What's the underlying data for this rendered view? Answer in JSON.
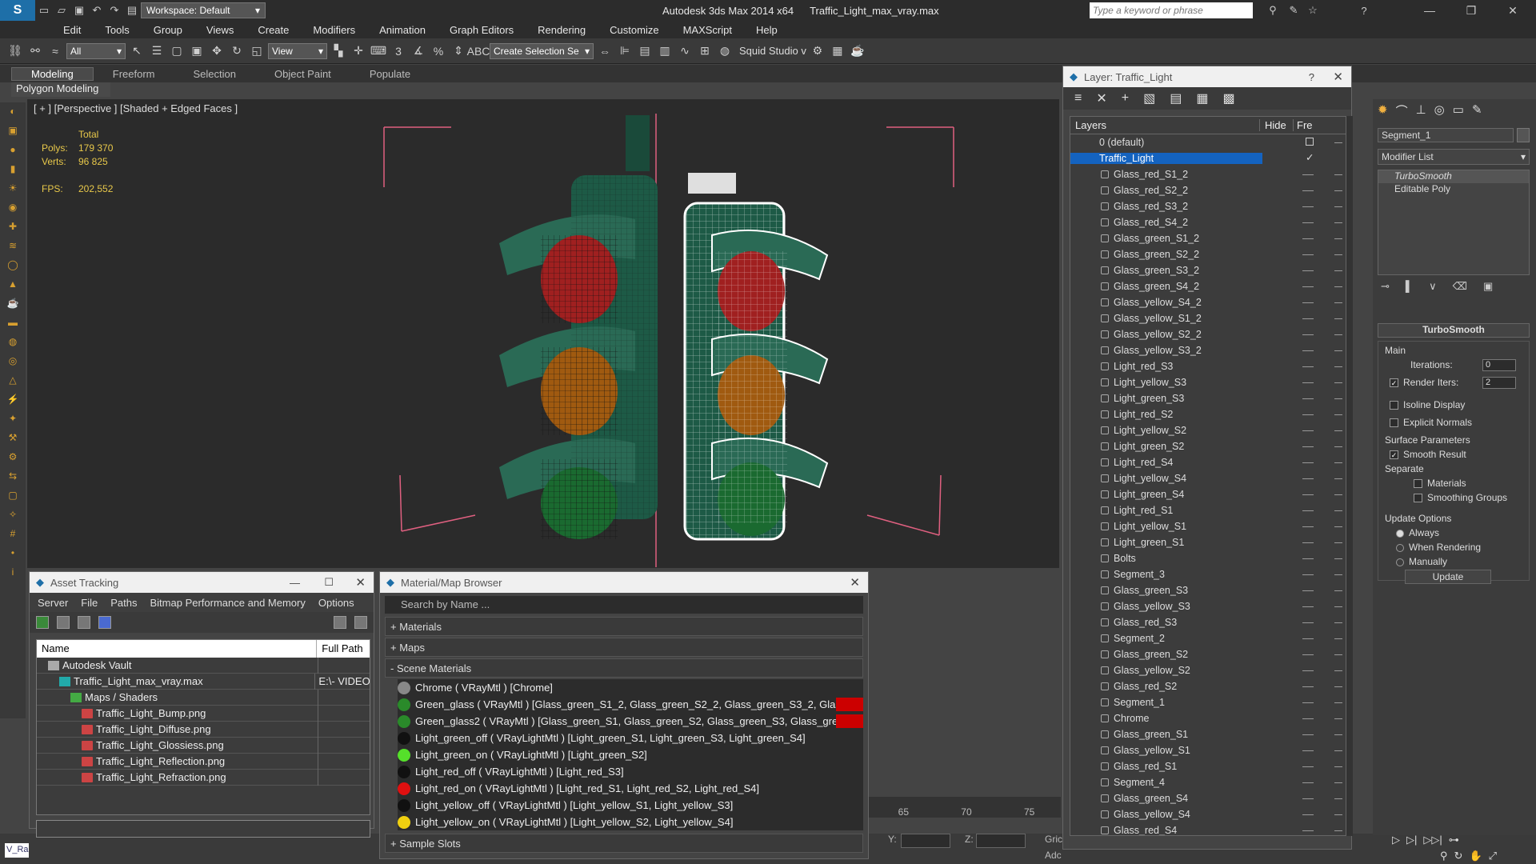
{
  "app": {
    "title": "Autodesk 3ds Max 2014 x64",
    "file": "Traffic_Light_max_vray.max",
    "workspace": "Workspace: Default",
    "search_placeholder": "Type a keyword or phrase"
  },
  "menu": [
    "Edit",
    "Tools",
    "Group",
    "Views",
    "Create",
    "Modifiers",
    "Animation",
    "Graph Editors",
    "Rendering",
    "Customize",
    "MAXScript",
    "Help"
  ],
  "toolbar": {
    "filter": "All",
    "refcoord": "View",
    "selection_set": "Create Selection Se",
    "squid": "Squid Studio v"
  },
  "ribbon": {
    "tabs": [
      "Modeling",
      "Freeform",
      "Selection",
      "Object Paint",
      "Populate"
    ],
    "sub": "Polygon Modeling"
  },
  "viewport": {
    "label": "[ + ] [Perspective ] [Shaded + Edged Faces ]",
    "total_label": "Total",
    "polys_label": "Polys:",
    "polys": "179 370",
    "verts_label": "Verts:",
    "verts": "96 825",
    "fps_label": "FPS:",
    "fps": "202,552"
  },
  "asset_tracking": {
    "title": "Asset Tracking",
    "menu": [
      "Server",
      "File",
      "Paths",
      "Bitmap Performance and Memory",
      "Options"
    ],
    "col_name": "Name",
    "col_path": "Full Path",
    "rows": [
      {
        "name": "Autodesk Vault",
        "path": "",
        "indent": 1,
        "icon": "vault"
      },
      {
        "name": "Traffic_Light_max_vray.max",
        "path": "E:\\- VIDEO",
        "indent": 2,
        "icon": "max"
      },
      {
        "name": "Maps / Shaders",
        "path": "",
        "indent": 3,
        "icon": "folder"
      },
      {
        "name": "Traffic_Light_Bump.png",
        "path": "",
        "indent": 4,
        "icon": "png"
      },
      {
        "name": "Traffic_Light_Diffuse.png",
        "path": "",
        "indent": 4,
        "icon": "png"
      },
      {
        "name": "Traffic_Light_Glossiess.png",
        "path": "",
        "indent": 4,
        "icon": "png"
      },
      {
        "name": "Traffic_Light_Reflection.png",
        "path": "",
        "indent": 4,
        "icon": "png"
      },
      {
        "name": "Traffic_Light_Refraction.png",
        "path": "",
        "indent": 4,
        "icon": "png"
      }
    ]
  },
  "material_browser": {
    "title": "Material/Map Browser",
    "search_placeholder": "Search by Name ...",
    "sec_materials": "+ Materials",
    "sec_maps": "+ Maps",
    "sec_scene": "- Scene Materials",
    "sec_samples": "+ Sample Slots",
    "rows": [
      {
        "label": "Chrome  ( VRayMtl )  [Chrome]",
        "color": "#888888",
        "flag": false
      },
      {
        "label": "Green_glass  ( VRayMtl )  [Glass_green_S1_2, Glass_green_S2_2, Glass_green_S3_2, Glass_...",
        "color": "#2a8a2a",
        "flag": true
      },
      {
        "label": "Green_glass2  ( VRayMtl )  [Glass_green_S1, Glass_green_S2, Glass_green_S3, Glass_green...",
        "color": "#2a8a2a",
        "flag": true
      },
      {
        "label": "Light_green_off  ( VRayLightMtl )  [Light_green_S1, Light_green_S3, Light_green_S4]",
        "color": "#111111",
        "flag": false
      },
      {
        "label": "Light_green_on  ( VRayLightMtl )  [Light_green_S2]",
        "color": "#55e02a",
        "flag": false
      },
      {
        "label": "Light_red_off  ( VRayLightMtl )  [Light_red_S3]",
        "color": "#111111",
        "flag": false
      },
      {
        "label": "Light_red_on  ( VRayLightMtl )  [Light_red_S1, Light_red_S2, Light_red_S4]",
        "color": "#e01010",
        "flag": false
      },
      {
        "label": "Light_yellow_off  ( VRayLightMtl )  [Light_yellow_S1, Light_yellow_S3]",
        "color": "#111111",
        "flag": false
      },
      {
        "label": "Light_yellow_on  ( VRayLightMtl )  [Light_yellow_S2, Light_yellow_S4]",
        "color": "#f0d010",
        "flag": false
      }
    ]
  },
  "layer_explorer": {
    "title": "Layer: Traffic_Light",
    "col_layers": "Layers",
    "col_hide": "Hide",
    "col_freeze": "Fre",
    "default_layer": "0 (default)",
    "active_layer": "Traffic_Light",
    "items": [
      "Glass_red_S1_2",
      "Glass_red_S2_2",
      "Glass_red_S3_2",
      "Glass_red_S4_2",
      "Glass_green_S1_2",
      "Glass_green_S2_2",
      "Glass_green_S3_2",
      "Glass_green_S4_2",
      "Glass_yellow_S4_2",
      "Glass_yellow_S1_2",
      "Glass_yellow_S2_2",
      "Glass_yellow_S3_2",
      "Light_red_S3",
      "Light_yellow_S3",
      "Light_green_S3",
      "Light_red_S2",
      "Light_yellow_S2",
      "Light_green_S2",
      "Light_red_S4",
      "Light_yellow_S4",
      "Light_green_S4",
      "Light_red_S1",
      "Light_yellow_S1",
      "Light_green_S1",
      "Bolts",
      "Segment_3",
      "Glass_green_S3",
      "Glass_yellow_S3",
      "Glass_red_S3",
      "Segment_2",
      "Glass_green_S2",
      "Glass_yellow_S2",
      "Glass_red_S2",
      "Segment_1",
      "Chrome",
      "Glass_green_S1",
      "Glass_yellow_S1",
      "Glass_red_S1",
      "Segment_4",
      "Glass_green_S4",
      "Glass_yellow_S4",
      "Glass_red_S4"
    ]
  },
  "command_panel": {
    "object_name": "Segment_1",
    "modifier_list": "Modifier List",
    "stack": [
      "TurboSmooth",
      "Editable Poly"
    ],
    "rollout": "TurboSmooth",
    "main": "Main",
    "iterations_label": "Iterations:",
    "iterations": "0",
    "render_iters_label": "Render Iters:",
    "render_iters": "2",
    "isoline": "Isoline Display",
    "explicit": "Explicit Normals",
    "surface": "Surface Parameters",
    "smooth": "Smooth Result",
    "separate": "Separate",
    "materials": "Materials",
    "smoothing": "Smoothing Groups",
    "update_options": "Update Options",
    "always": "Always",
    "when_rendering": "When Rendering",
    "manually": "Manually",
    "update_btn": "Update"
  },
  "timeline": {
    "ticks": [
      "65",
      "70",
      "75"
    ]
  },
  "status": {
    "y_label": "Y:",
    "z_label": "Z:",
    "grid": "Gric",
    "add": "Adc",
    "script": "V_Ra"
  }
}
